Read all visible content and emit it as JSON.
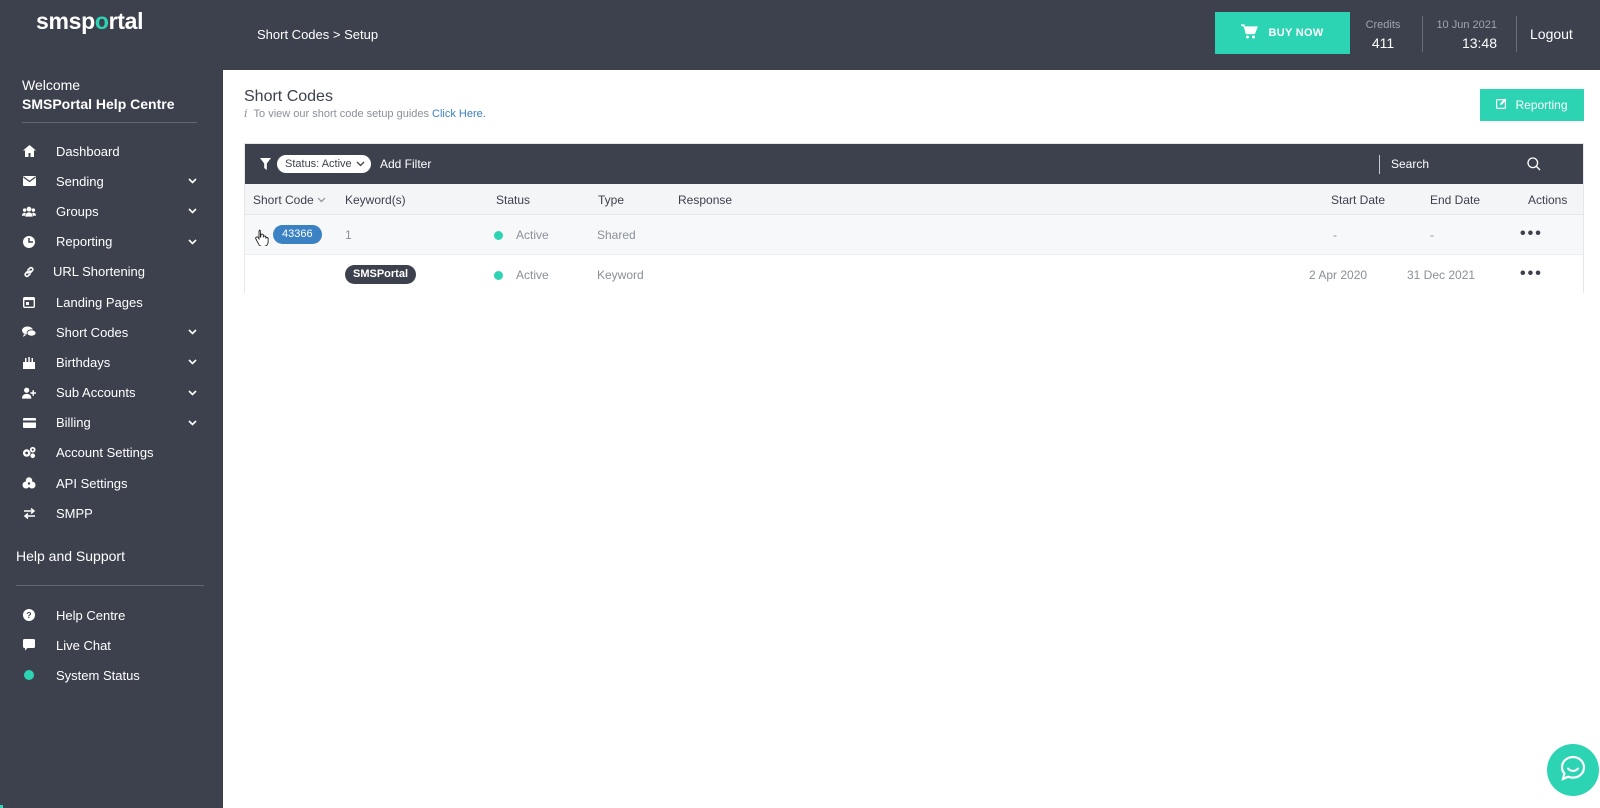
{
  "sidebar": {
    "logo": {
      "prefix": "smsp",
      "dot": "o",
      "suffix": "rtal"
    },
    "welcome": "Welcome",
    "org_name": "SMSPortal Help Centre",
    "items": [
      {
        "label": "Dashboard",
        "icon": "home-icon",
        "expandable": false
      },
      {
        "label": "Sending",
        "icon": "envelope-icon",
        "expandable": true
      },
      {
        "label": "Groups",
        "icon": "users-icon",
        "expandable": true
      },
      {
        "label": "Reporting",
        "icon": "chart-icon",
        "expandable": true
      },
      {
        "label": "URL Shortening",
        "icon": "link-icon",
        "expandable": false
      },
      {
        "label": "Landing Pages",
        "icon": "page-icon",
        "expandable": false
      },
      {
        "label": "Short Codes",
        "icon": "chat-bubbles-icon",
        "expandable": true
      },
      {
        "label": "Birthdays",
        "icon": "cake-icon",
        "expandable": true
      },
      {
        "label": "Sub Accounts",
        "icon": "user-plus-icon",
        "expandable": true
      },
      {
        "label": "Billing",
        "icon": "credit-card-icon",
        "expandable": true
      },
      {
        "label": "Account Settings",
        "icon": "cogs-icon",
        "expandable": false
      },
      {
        "label": "API Settings",
        "icon": "api-icon",
        "expandable": false
      },
      {
        "label": "SMPP",
        "icon": "exchange-icon",
        "expandable": false
      }
    ],
    "help_title": "Help and Support",
    "help_items": [
      {
        "label": "Help Centre",
        "icon": "question-circle-icon"
      },
      {
        "label": "Live Chat",
        "icon": "chat-icon"
      },
      {
        "label": "System Status",
        "icon": "status-dot-icon"
      }
    ]
  },
  "topbar": {
    "breadcrumb": "Short Codes > Setup",
    "buy_now": "BUY NOW",
    "credits_label": "Credits",
    "credits_value": "411",
    "date": "10 Jun 2021",
    "time": "13:48",
    "logout": "Logout"
  },
  "main": {
    "title": "Short Codes",
    "info_text": "To view our short code setup guides",
    "info_link": "Click Here.",
    "reporting_button": "Reporting",
    "filter": {
      "status_chip": "Status: Active",
      "add_filter": "Add Filter",
      "search_placeholder": "Search"
    },
    "columns": {
      "short_code": "Short Code",
      "keywords": "Keyword(s)",
      "status": "Status",
      "type": "Type",
      "response": "Response",
      "start_date": "Start Date",
      "end_date": "End Date",
      "actions": "Actions"
    },
    "rows": [
      {
        "short_code": "43366",
        "keywords": "1",
        "status": "Active",
        "type": "Shared",
        "response": "",
        "start_date": "-",
        "end_date": "-"
      },
      {
        "short_code": "",
        "keywords": "SMSPortal",
        "status": "Active",
        "type": "Keyword",
        "response": "",
        "start_date": "2 Apr 2020",
        "end_date": "31 Dec 2021"
      }
    ]
  },
  "colors": {
    "sidebar_bg": "#3d414d",
    "accent": "#2dd4b4",
    "link": "#3b82c4"
  }
}
